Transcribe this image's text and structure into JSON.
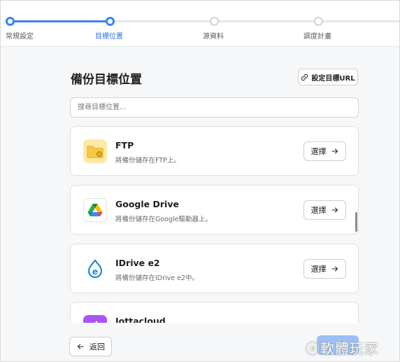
{
  "stepper": {
    "steps": [
      {
        "label": "常規設定",
        "state": "done"
      },
      {
        "label": "目標位置",
        "state": "active"
      },
      {
        "label": "源資料",
        "state": "pending"
      },
      {
        "label": "調度計畫",
        "state": "pending"
      }
    ],
    "accent_color": "#3b82f6"
  },
  "main": {
    "title": "備份目標位置",
    "set_url_button": {
      "label": "設定目標URL",
      "icon": "link-icon"
    },
    "search": {
      "placeholder": "搜尋目標位置..."
    },
    "destinations": [
      {
        "name": "FTP",
        "description": "將備份儲存在FTP上。",
        "icon": "folder-gear-icon",
        "action": "選擇"
      },
      {
        "name": "Google Drive",
        "description": "將備份儲存在Google驅動器上。",
        "icon": "google-drive-icon",
        "action": "選擇"
      },
      {
        "name": "IDrive e2",
        "description": "將備份儲存在IDrive e2中。",
        "icon": "idrive-e2-icon",
        "action": "選擇"
      },
      {
        "name": "Jottacloud",
        "description": "",
        "icon": "jottacloud-icon",
        "action": ""
      }
    ]
  },
  "footer": {
    "back_label": "返回",
    "back_icon": "arrow-left-icon"
  },
  "watermark": {
    "text": "ⓔ軟體玩家"
  }
}
